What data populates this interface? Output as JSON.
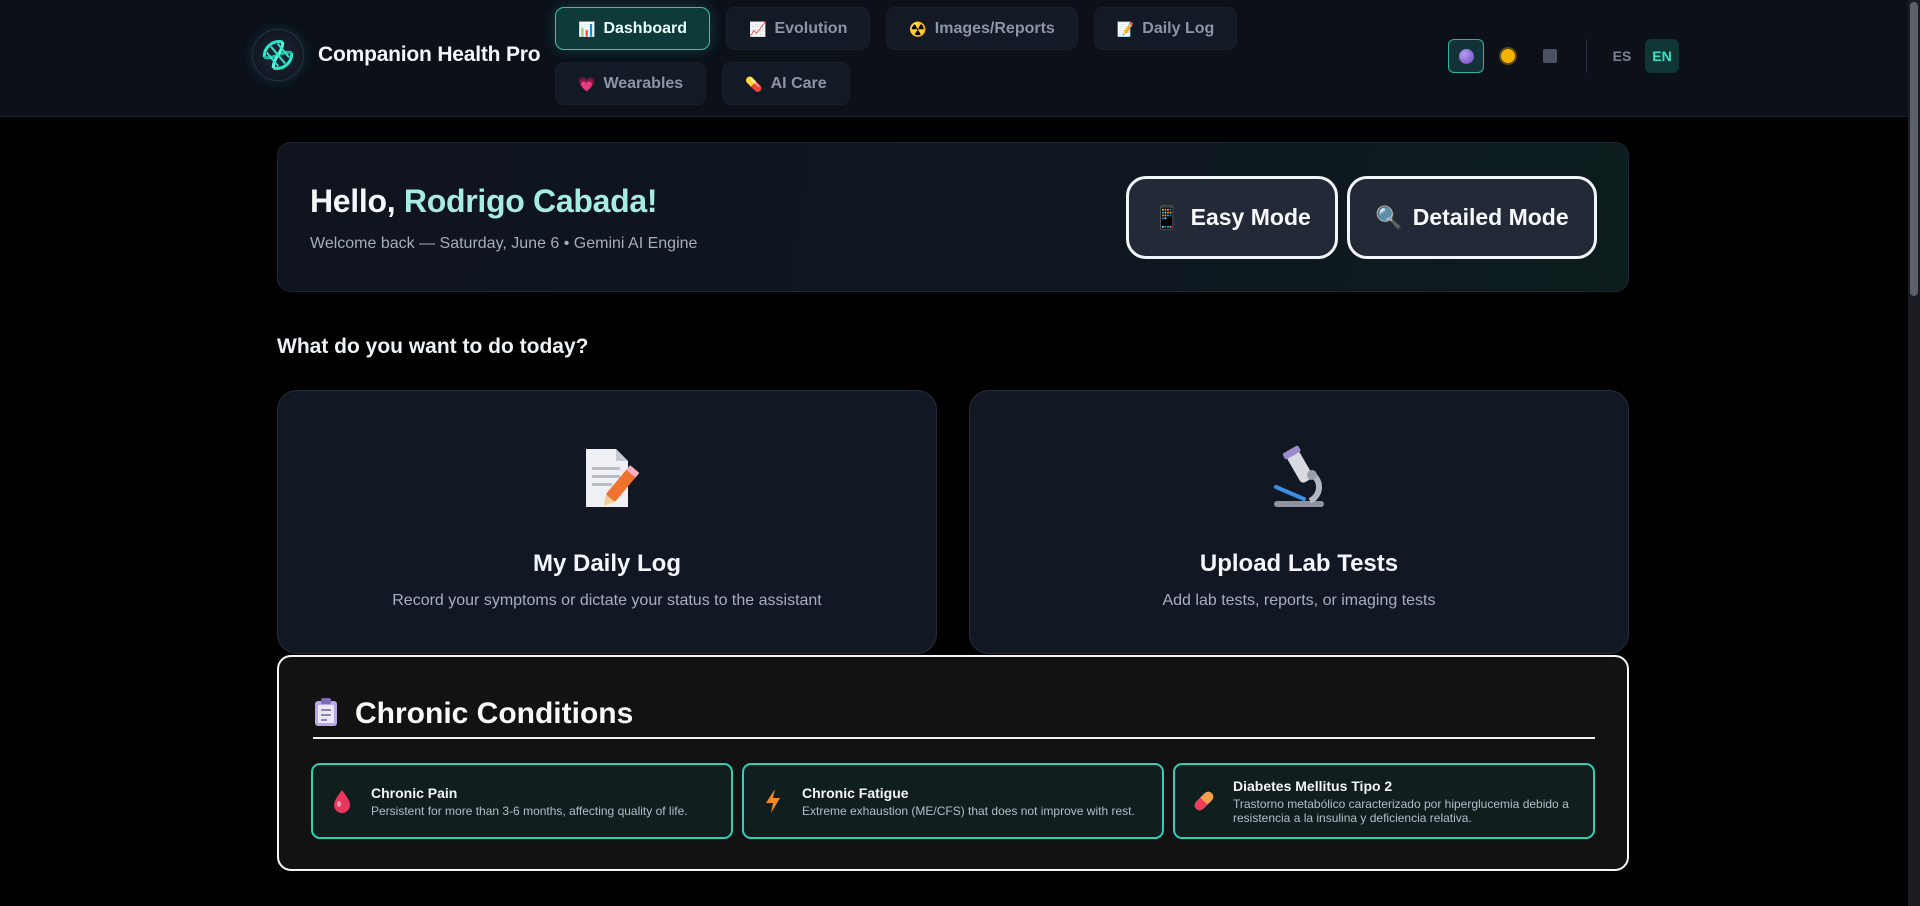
{
  "app": {
    "name": "Companion Health Pro",
    "logo_icon": "dna-icon"
  },
  "nav": {
    "tabs": [
      {
        "label": "Dashboard",
        "icon": "bar-chart-icon",
        "glyph": "📊",
        "active": true
      },
      {
        "label": "Evolution",
        "icon": "trend-chart-icon",
        "glyph": "📈",
        "active": false
      },
      {
        "label": "Images/Reports",
        "icon": "radioactive-icon",
        "glyph": "☢️",
        "active": false
      },
      {
        "label": "Daily Log",
        "icon": "memo-icon",
        "glyph": "📝",
        "active": false
      },
      {
        "label": "Wearables",
        "icon": "heart-icon",
        "glyph": "💗",
        "active": false
      },
      {
        "label": "AI Care",
        "icon": "pill-icon",
        "glyph": "💊",
        "active": false
      }
    ]
  },
  "controls": {
    "themes": [
      {
        "icon": "purple-theme-icon",
        "active": true
      },
      {
        "icon": "sun-theme-icon",
        "active": false
      },
      {
        "icon": "dark-square-theme-icon",
        "active": false
      }
    ],
    "languages": [
      {
        "label": "ES",
        "active": false
      },
      {
        "label": "EN",
        "active": true
      }
    ]
  },
  "hero": {
    "greeting": "Hello,",
    "user_name": "Rodrigo Cabada!",
    "subtitle": "Welcome back — Saturday, June 6 • Gemini AI Engine",
    "easy_mode": {
      "label": "Easy Mode",
      "icon": "mobile-phone-icon",
      "glyph": "📱"
    },
    "detailed_mode": {
      "label": "Detailed Mode",
      "icon": "magnifier-icon",
      "glyph": "🔍"
    }
  },
  "section_question": "What do you want to do today?",
  "cards": [
    {
      "title": "My Daily Log",
      "description": "Record your symptoms or dictate your status to the assistant",
      "icon": "memo-icon"
    },
    {
      "title": "Upload Lab Tests",
      "description": "Add lab tests, reports, or imaging tests",
      "icon": "microscope-icon"
    }
  ],
  "chronic": {
    "title": "Chronic Conditions",
    "icon": "clipboard-icon",
    "conditions": [
      {
        "name": "Chronic Pain",
        "description": "Persistent for more than 3-6 months, affecting quality of life.",
        "icon": "drop-icon"
      },
      {
        "name": "Chronic Fatigue",
        "description": "Extreme exhaustion (ME/CFS) that does not improve with rest.",
        "icon": "lightning-icon"
      },
      {
        "name": "Diabetes Mellitus Tipo 2",
        "description": "Trastorno metabólico caracterizado por hiperglucemia debido a resistencia a la insulina y deficiencia relativa.",
        "icon": "pill-icon"
      }
    ]
  },
  "colors": {
    "accent": "#2fd0b4",
    "background": "#000000",
    "topbar": "#0b1019",
    "card": "#111723"
  }
}
